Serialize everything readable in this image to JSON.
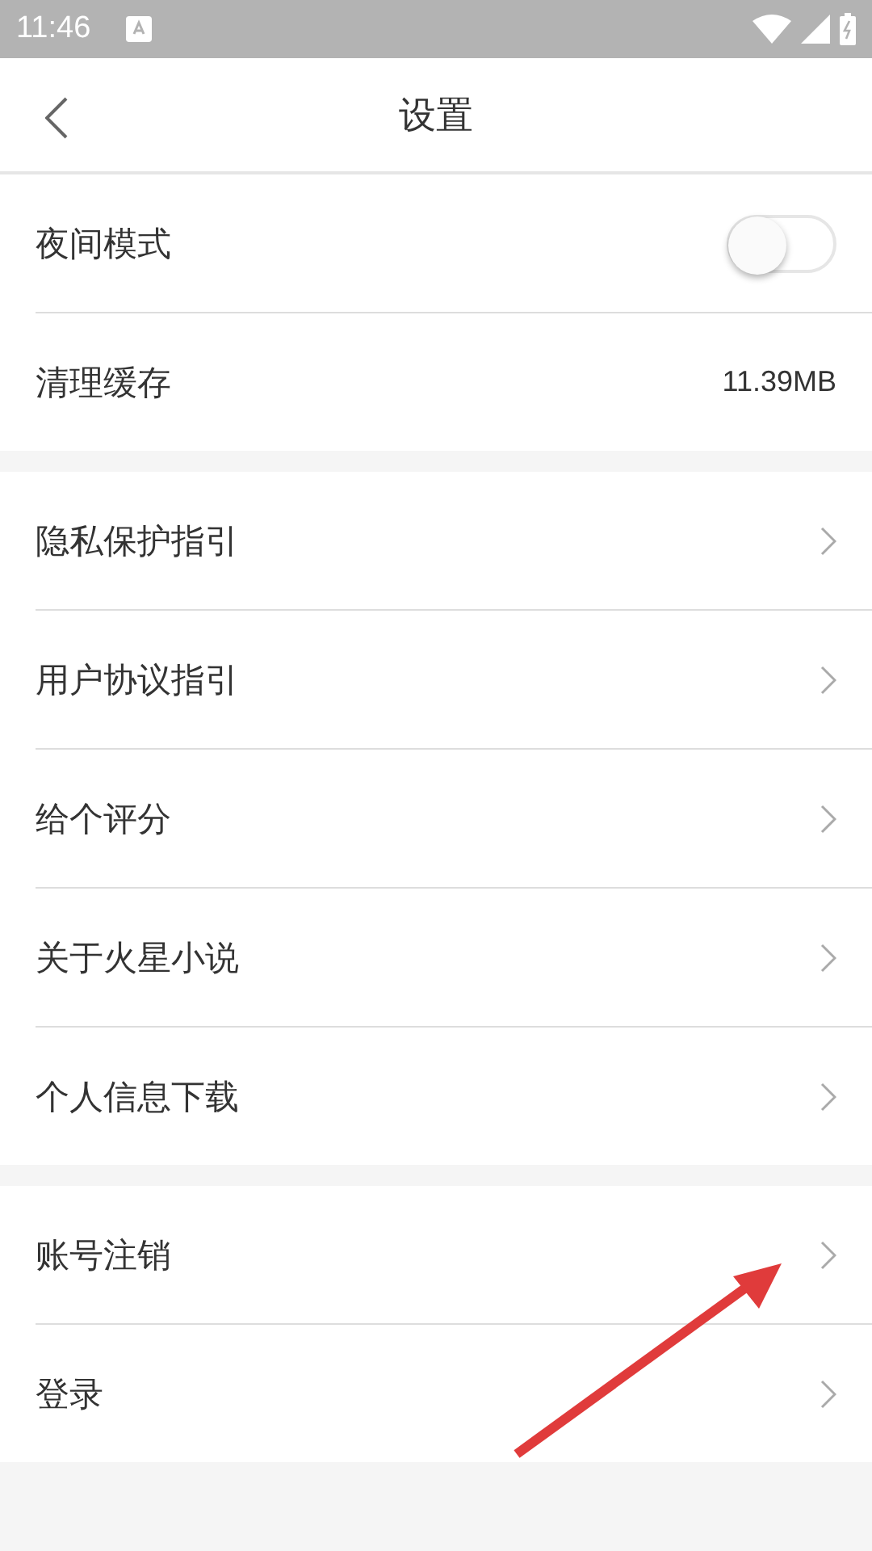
{
  "status_bar": {
    "time": "11:46"
  },
  "header": {
    "title": "设置"
  },
  "groups": [
    [
      {
        "kind": "toggle",
        "label": "夜间模式",
        "on": false
      },
      {
        "kind": "value",
        "label": "清理缓存",
        "value": "11.39MB"
      }
    ],
    [
      {
        "kind": "link",
        "label": "隐私保护指引"
      },
      {
        "kind": "link",
        "label": "用户协议指引"
      },
      {
        "kind": "link",
        "label": "给个评分"
      },
      {
        "kind": "link",
        "label": "关于火星小说"
      },
      {
        "kind": "link",
        "label": "个人信息下载"
      }
    ],
    [
      {
        "kind": "link",
        "label": "账号注销"
      },
      {
        "kind": "link",
        "label": "登录"
      }
    ]
  ]
}
